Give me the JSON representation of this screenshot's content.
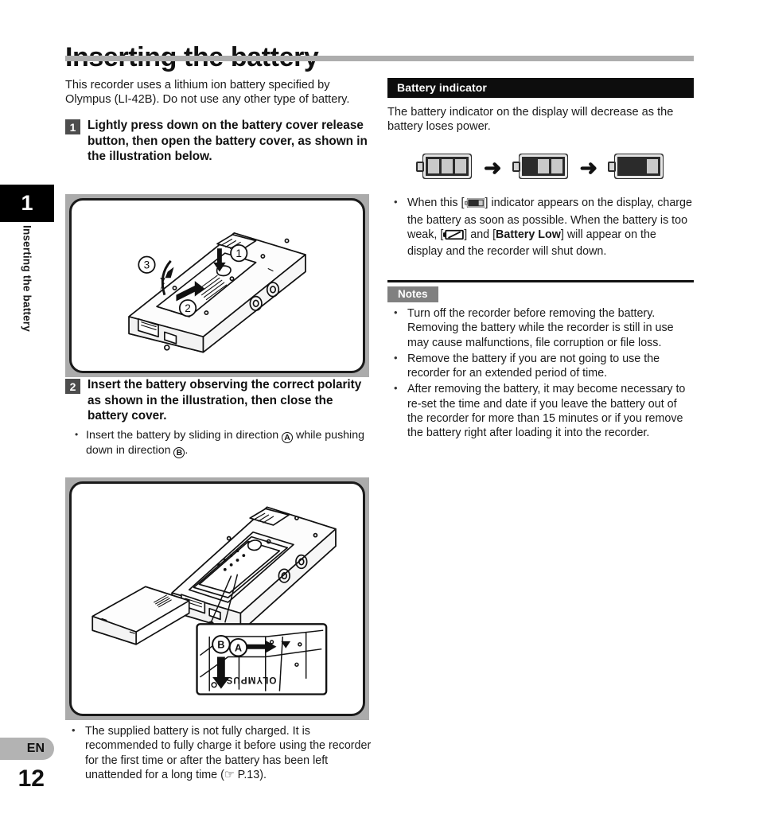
{
  "page_title": "Inserting the battery",
  "sidebar": {
    "chapter_number": "1",
    "chapter_label": "Inserting the battery",
    "language": "EN",
    "page_number": "12"
  },
  "left_column": {
    "intro": "This recorder uses a lithium ion battery specified by Olympus (LI-42B). Do not use any other type of battery.",
    "step1": {
      "number": "1",
      "text": "Lightly press down on the battery cover release button, then open the battery cover, as shown in the illustration below."
    },
    "figure1": {
      "caption": "",
      "callouts": [
        "1",
        "2",
        "3"
      ]
    },
    "step2": {
      "number": "2",
      "text": "Insert the battery observing the correct polarity as shown in the illustration, then close the battery cover.",
      "sub_bullet_part1": "Insert the battery by sliding in direction",
      "sub_bullet_marker_a": "A",
      "sub_bullet_part2": "while pushing down in direction",
      "sub_bullet_marker_b": "B",
      "sub_bullet_part3": "."
    },
    "figure2": {
      "callouts": [
        "A",
        "B"
      ],
      "battery_brand": "OLYMPUS"
    },
    "footnote": "The supplied battery is not fully charged. It is recommended to fully charge it before using the recorder for the first time or after the battery has been left unattended for a long time (☞ P.13)."
  },
  "right_column": {
    "section_title": "Battery indicator",
    "intro": "The battery indicator on the display will decrease as the battery loses power.",
    "indicator_sequence": {
      "steps": [
        {
          "name": "battery-full-icon",
          "segments": 3
        },
        {
          "name": "battery-two-thirds-icon",
          "segments": 2
        },
        {
          "name": "battery-low-icon",
          "segments": 1
        }
      ],
      "arrow": "➜"
    },
    "warning_part1": "When this [",
    "warning_icon_1": "battery-low-icon",
    "warning_part2": "] indicator appears on the display, charge the battery as soon as possible. When the battery is too weak, [",
    "warning_icon_2": "battery-empty-slash-icon",
    "warning_part3": "] and [",
    "warning_bold": "Battery Low",
    "warning_part4": "] will appear on the display and the recorder will shut down.",
    "notes": {
      "badge": "Notes",
      "items": [
        "Turn off the recorder before removing the battery. Removing the battery while the recorder is still in use may cause malfunctions, file corruption or file loss.",
        "Remove the battery if you are not going to use the recorder for an extended period of time.",
        "After removing the battery, it may become necessary to re-set the time and date if you leave the battery out of the recorder for more than 15 minutes or if you remove the battery right after loading it into the recorder."
      ]
    }
  },
  "colors": {
    "title_rule": "#adadad",
    "section_bar": "#0d0d0d",
    "notes_badge": "#808080",
    "step_number_box": "#4d4d4d",
    "figure_frame": "#ababab",
    "lang_tab": "#b3b3b3"
  }
}
